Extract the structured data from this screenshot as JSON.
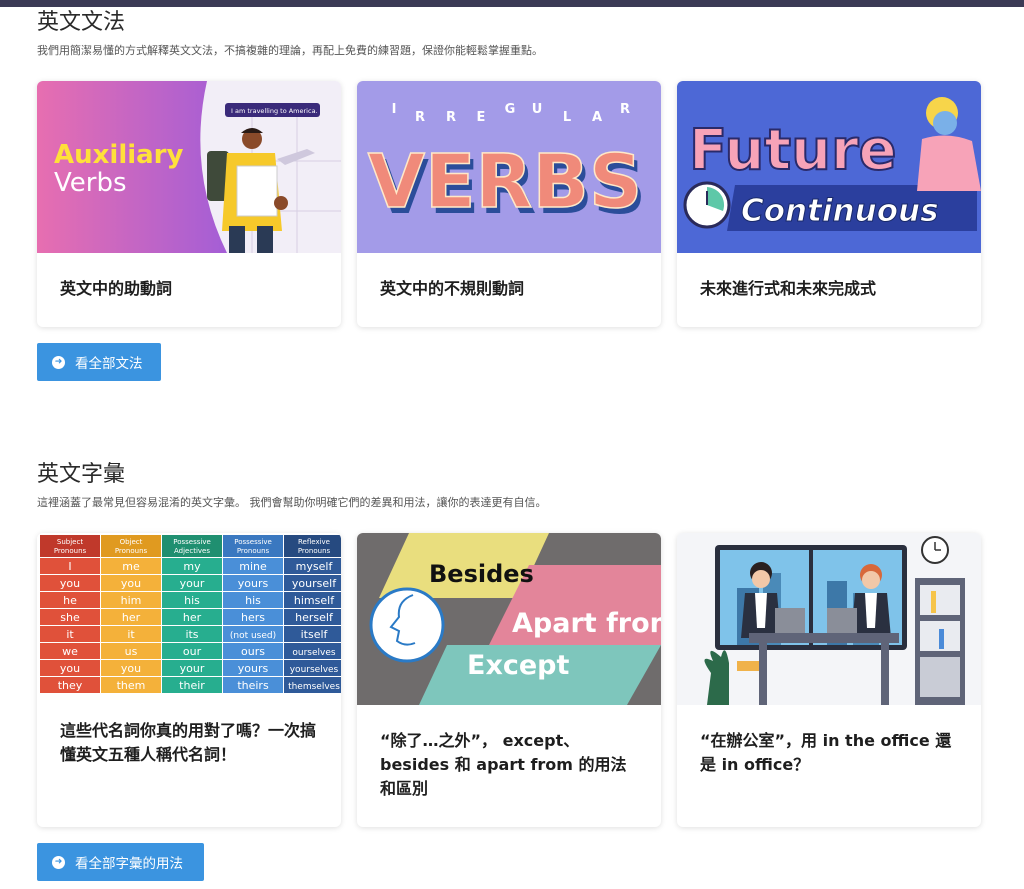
{
  "grammar": {
    "title": "英文文法",
    "description": "我們用簡潔易懂的方式解釋英文文法，不搞複雜的理論，再配上免費的練習題，保證你能輕鬆掌握重點。",
    "cards": [
      {
        "title": "英文中的助動詞",
        "image": {
          "line1": "Auxiliary",
          "line2": "Verbs",
          "bubble": "I am travelling to America."
        }
      },
      {
        "title": "英文中的不規則動詞",
        "image": {
          "letters": [
            "I",
            "R",
            "R",
            "E",
            "G",
            "U",
            "L",
            "A",
            "R"
          ],
          "word": "VERBS"
        }
      },
      {
        "title": "未來進行式和未來完成式",
        "image": {
          "line1": "Future",
          "line2": "Continuous"
        }
      }
    ],
    "button_label": "看全部文法"
  },
  "vocab": {
    "title": "英文字彙",
    "description": "這裡涵蓋了最常見但容易混淆的英文字彙。 我們會幫助你明確它們的差異和用法，讓你的表達更有自信。",
    "cards": [
      {
        "title": "這些代名詞你真的用對了嗎？一次搞懂英文五種人稱代名詞！",
        "image": {
          "headers": [
            "Subject Pronouns",
            "Object Pronouns",
            "Possessive Adjectives",
            "Possessive Pronouns",
            "Reflexive Pronouns"
          ],
          "rows": [
            [
              "I",
              "me",
              "my",
              "mine",
              "myself"
            ],
            [
              "you",
              "you",
              "your",
              "yours",
              "yourself"
            ],
            [
              "he",
              "him",
              "his",
              "his",
              "himself"
            ],
            [
              "she",
              "her",
              "her",
              "hers",
              "herself"
            ],
            [
              "it",
              "it",
              "its",
              "(not used)",
              "itself"
            ],
            [
              "we",
              "us",
              "our",
              "ours",
              "ourselves"
            ],
            [
              "you",
              "you",
              "your",
              "yours",
              "yourselves"
            ],
            [
              "they",
              "them",
              "their",
              "theirs",
              "themselves"
            ]
          ],
          "column_colors": [
            "#e0513a",
            "#f4b13a",
            "#27ae8f",
            "#4a8fd8",
            "#2f5a99"
          ]
        }
      },
      {
        "title": "“除了…之外”， except、besides 和 apart from 的用法和區別",
        "image": {
          "word1": "Besides",
          "word2": "Apart from",
          "word3": "Except"
        }
      },
      {
        "title": "“在辦公室”，用 in the office 還是 in office？",
        "image": {
          "scene": "office-illustration"
        }
      }
    ],
    "button_label": "看全部字彙的用法"
  },
  "icons": {
    "button_icon": "arrow-circle-right-icon"
  },
  "colors": {
    "accent": "#3b94e0",
    "topbar": "#3b3a55"
  }
}
